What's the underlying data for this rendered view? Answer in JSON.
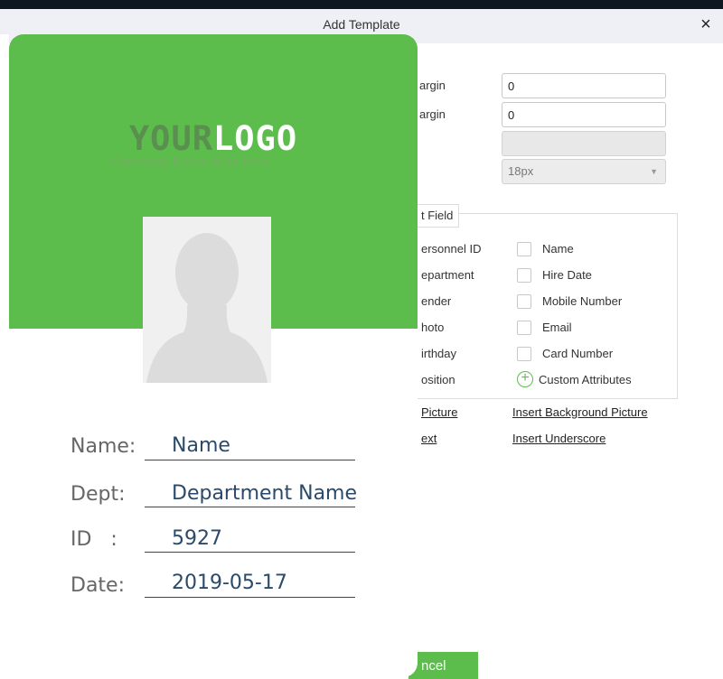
{
  "dialog": {
    "title": "Add Template",
    "close_glyph": "×"
  },
  "settings": {
    "top_margin_label": "argin",
    "left_margin_label": "argin",
    "top_margin_value": "0",
    "left_margin_value": "0",
    "font_size_value": "18px"
  },
  "select_field": {
    "legend": "t Field",
    "left_items": [
      "ersonnel ID",
      "epartment",
      "ender",
      "hoto",
      "irthday",
      "osition"
    ],
    "right_items": [
      "Name",
      "Hire Date",
      "Mobile Number",
      "Email",
      "Card Number"
    ],
    "custom_attributes": "Custom Attributes"
  },
  "links": {
    "insert_picture": "Picture",
    "insert_background_picture": "Insert Background Picture",
    "insert_text": "ext",
    "insert_underscore": "Insert Underscore"
  },
  "buttons": {
    "cancel": "ncel"
  },
  "card": {
    "logo_part1": "YOUR",
    "logo_part2": "LOGO",
    "tagline": "Company Name fill in here",
    "fields": [
      {
        "label": "Name:",
        "value": "Name"
      },
      {
        "label": "Dept:",
        "value": "Department Name"
      },
      {
        "label": "ID   :",
        "value": "5927"
      },
      {
        "label": "Date:",
        "value": "2019-05-17"
      }
    ]
  },
  "colors": {
    "accent": "#5cbd4d",
    "titlebar": "#eef0f5",
    "value_text": "#2b4a6a"
  }
}
